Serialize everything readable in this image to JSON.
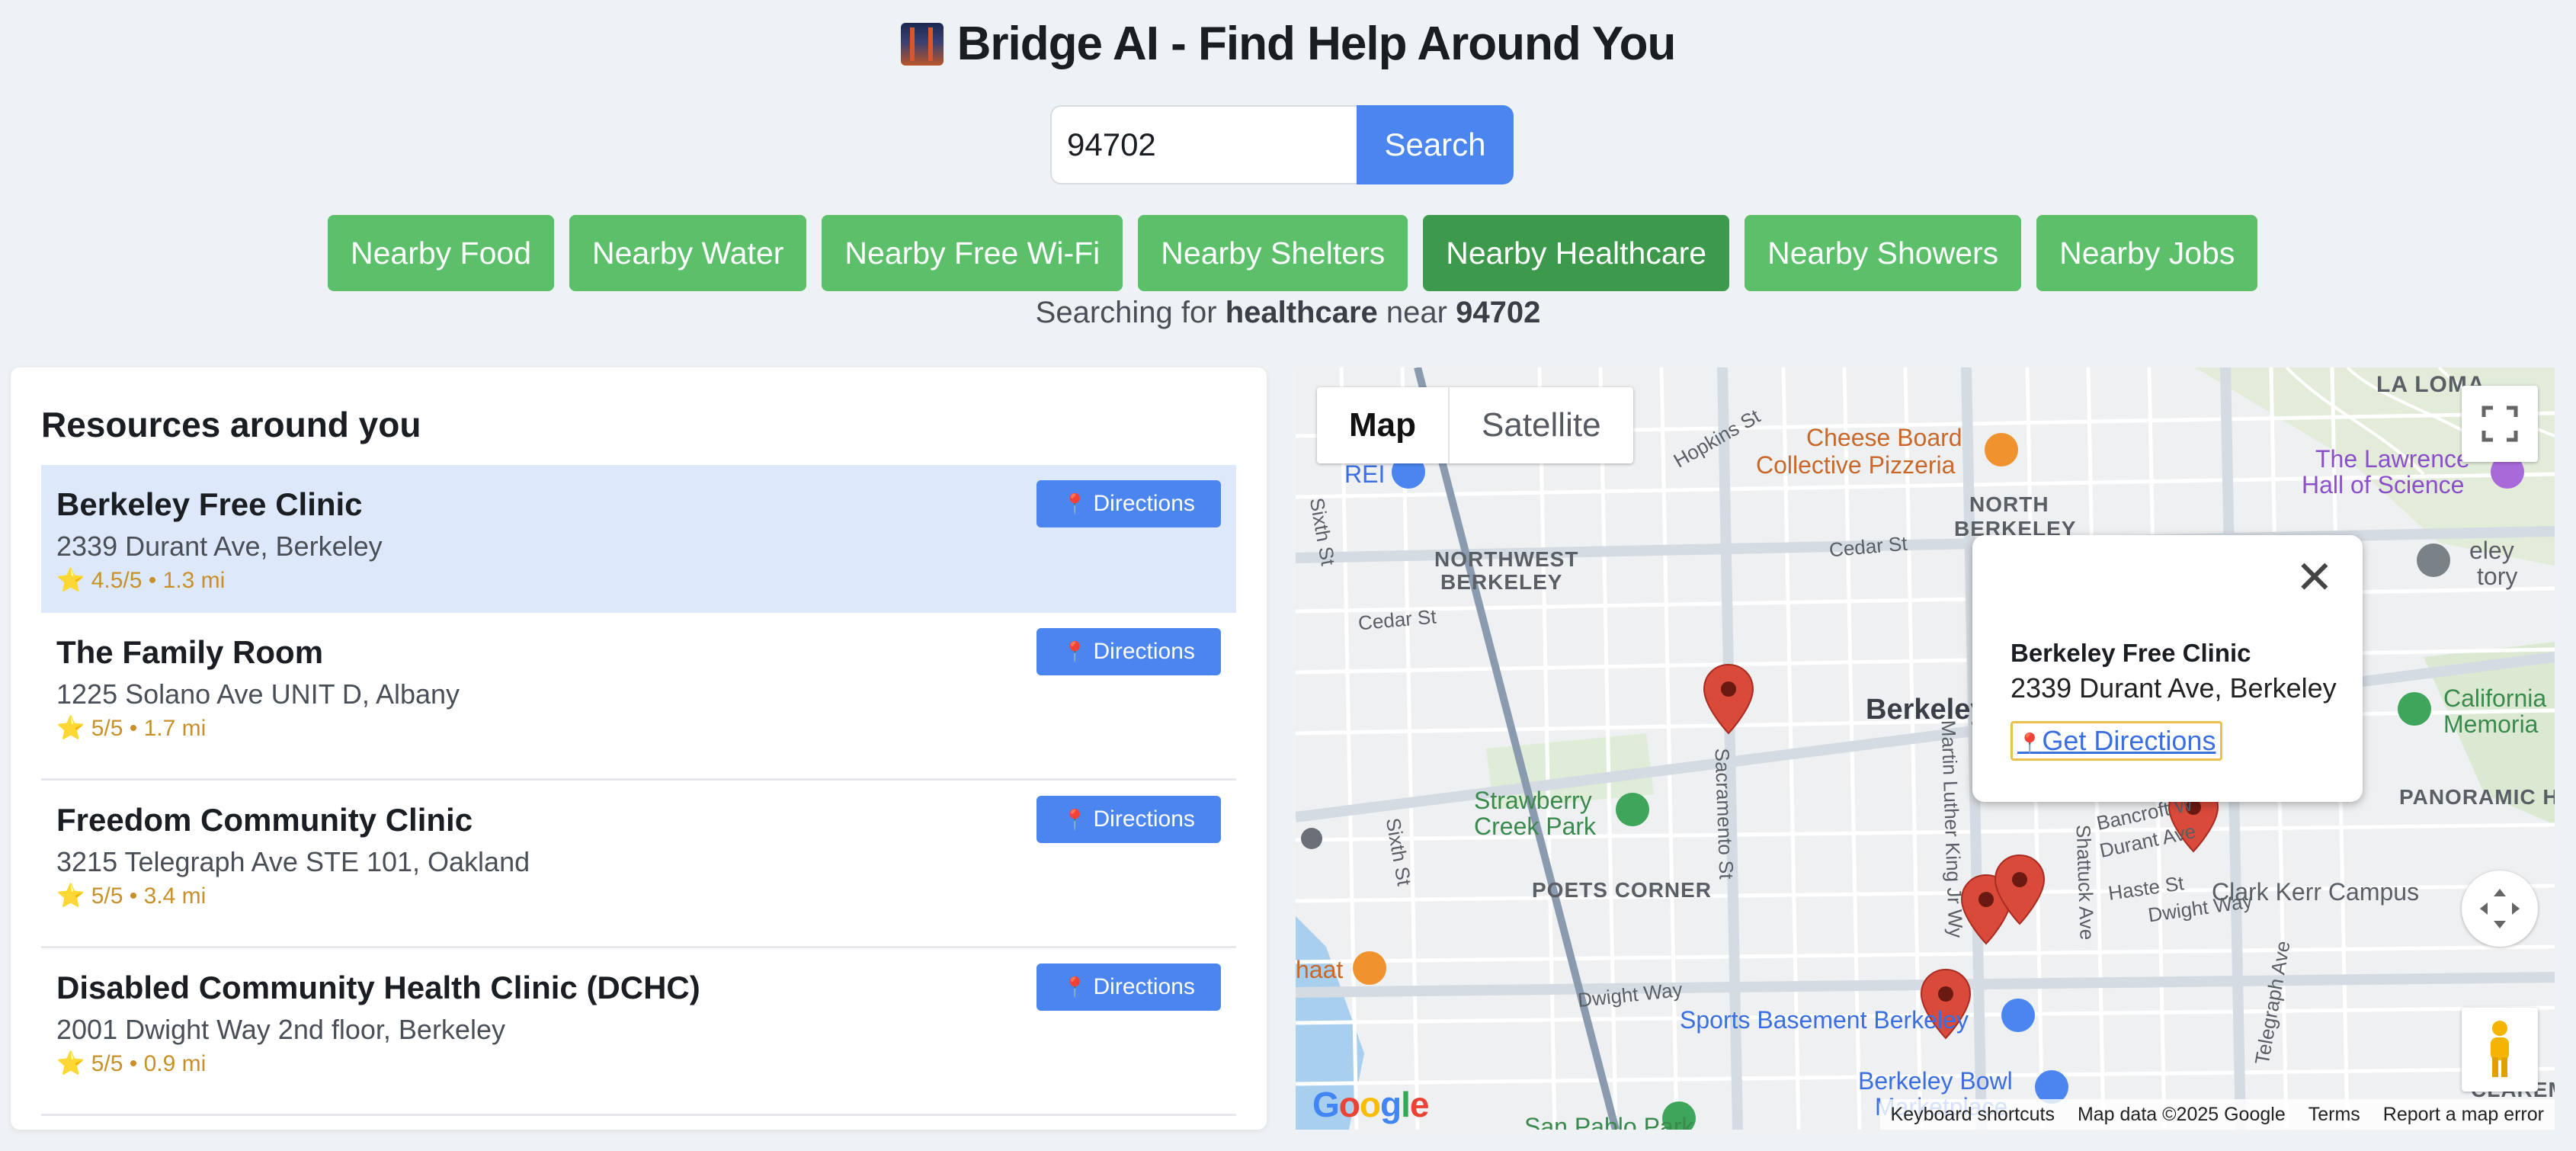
{
  "header": {
    "title": "Bridge AI - Find Help Around You",
    "logo_icon": "bridge-icon"
  },
  "search": {
    "value": "94702",
    "placeholder": "",
    "button_label": "Search"
  },
  "categories": [
    {
      "label": "Nearby Food",
      "active": false
    },
    {
      "label": "Nearby Water",
      "active": false
    },
    {
      "label": "Nearby Free Wi-Fi",
      "active": false
    },
    {
      "label": "Nearby Shelters",
      "active": false
    },
    {
      "label": "Nearby Healthcare",
      "active": true
    },
    {
      "label": "Nearby Showers",
      "active": false
    },
    {
      "label": "Nearby Jobs",
      "active": false
    }
  ],
  "status": {
    "prefix": "Searching for",
    "term": "healthcare",
    "middle": "near",
    "zip": "94702"
  },
  "resources": {
    "title": "Resources around you",
    "directions_label": "Directions",
    "items": [
      {
        "name": "Berkeley Free Clinic",
        "address": "2339 Durant Ave, Berkeley",
        "meta": "⭐ 4.5/5 • 1.3 mi",
        "selected": true
      },
      {
        "name": "The Family Room",
        "address": "1225 Solano Ave UNIT D, Albany",
        "meta": "⭐ 5/5 • 1.7 mi",
        "selected": false
      },
      {
        "name": "Freedom Community Clinic",
        "address": "3215 Telegraph Ave STE 101, Oakland",
        "meta": "⭐ 5/5 • 3.4 mi",
        "selected": false
      },
      {
        "name": "Disabled Community Health Clinic (DCHC)",
        "address": "2001 Dwight Way 2nd floor, Berkeley",
        "meta": "⭐ 5/5 • 0.9 mi",
        "selected": false
      }
    ]
  },
  "map": {
    "type_map": "Map",
    "type_satellite": "Satellite",
    "popup": {
      "name": "Berkeley Free Clinic",
      "address": "2339 Durant Ave, Berkeley",
      "link": "Get Directions"
    },
    "labels": {
      "la_loma": "LA LOMA",
      "hopkins": "Hopkins St",
      "cheese_board": "Cheese Board",
      "cheese_board2": "Collective Pizzeria",
      "lawrence": "The Lawrence",
      "lawrence2": "Hall of Science",
      "rei": "REI",
      "north_berkeley": "NORTH",
      "north_berkeley2": "BERKELEY",
      "cedar1": "Cedar St",
      "cedar2": "Cedar St",
      "northwest": "NORTHWEST",
      "northwest2": "BERKELEY",
      "sixth1": "Sixth St",
      "sixth2": "Sixth St",
      "berkeley": "Berkeley",
      "strawberry": "Strawberry",
      "strawberry2": "Creek Park",
      "sacramento": "Sacramento St",
      "mlk": "Martin Luther King Jr Wy",
      "poets": "POETS CORNER",
      "bancroft": "Bancroft W",
      "durant": "Durant Ave",
      "haste": "Haste St",
      "dwight1": "Dwight Way",
      "dwight2": "Dwight Way",
      "shattuck": "Shattuck Ave",
      "california": "California",
      "california2": "Memoria",
      "panoramic": "PANORAMIC H",
      "clark_kerr": "Clark Kerr Campus",
      "telegraph": "Telegraph Ave",
      "sports_basement": "Sports Basement Berkeley",
      "berkeley_bowl": "Berkeley Bowl",
      "berkeley_bowl2": "Marketplace",
      "haat": "haat",
      "san_pablo": "San Pablo Park",
      "ley": "eley",
      "tory": "tory",
      "claremont": "CLAREM"
    },
    "attribution": [
      "Keyboard shortcuts",
      "Map data ©2025 Google",
      "Terms",
      "Report a map error"
    ],
    "google": "Google",
    "icons": [
      "fullscreen-icon",
      "camera-control-icon",
      "pegman-icon"
    ]
  }
}
